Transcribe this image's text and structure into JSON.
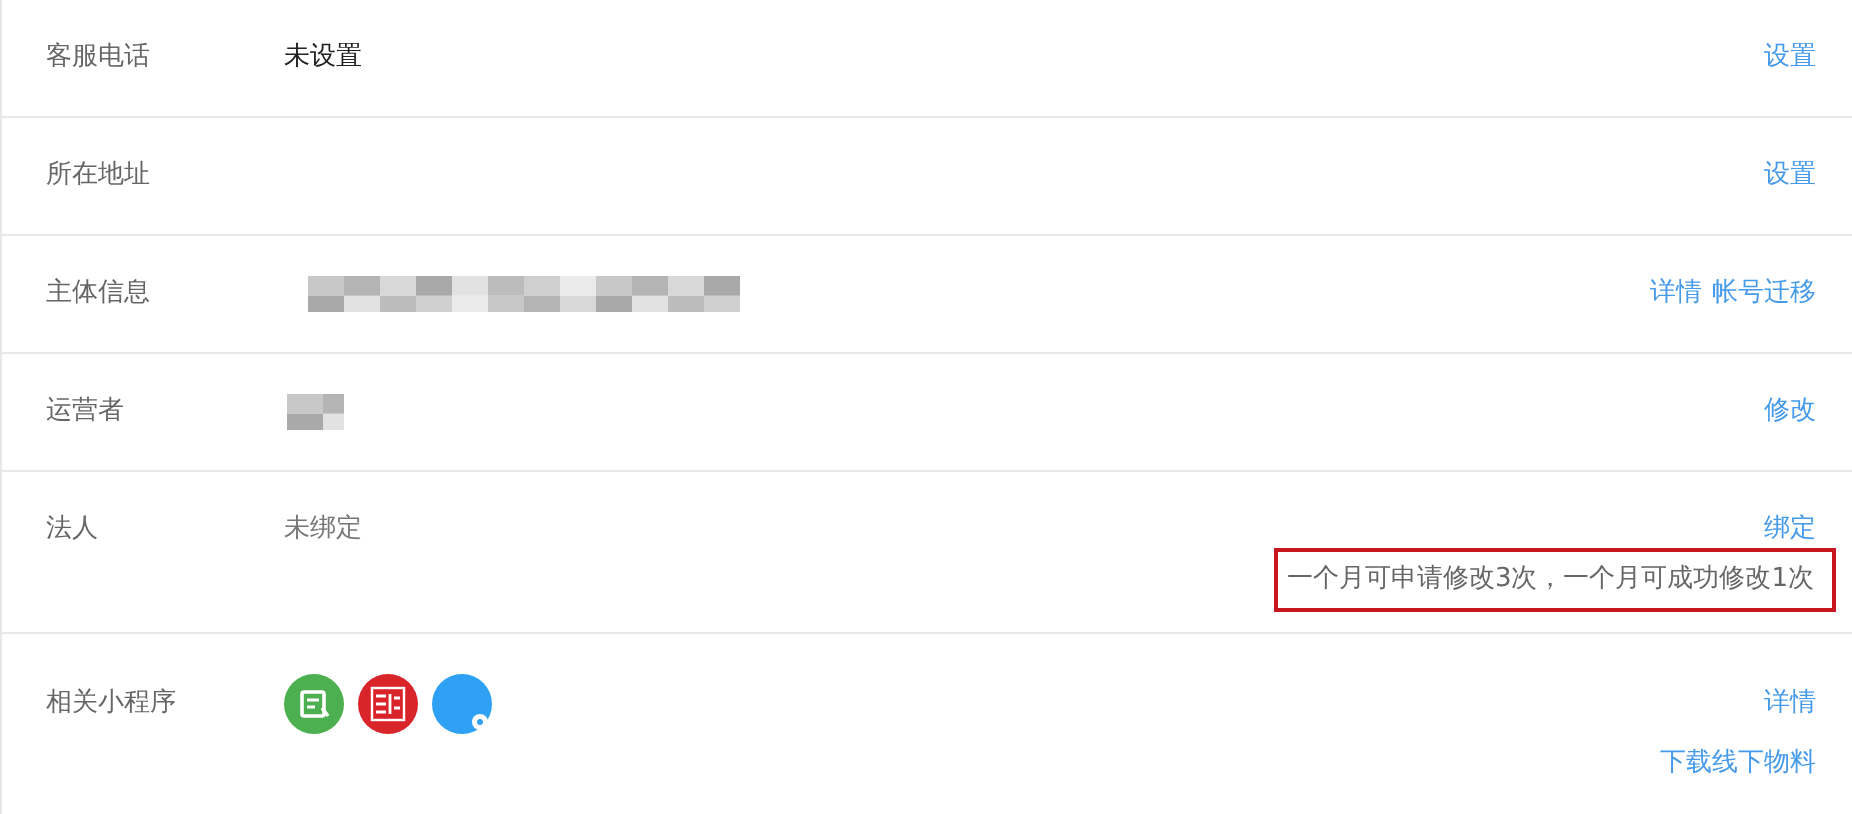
{
  "rows": [
    {
      "label": "客服电话",
      "value": {
        "kind": "text",
        "text": "未设置"
      },
      "action_lines": [
        [
          "设置"
        ]
      ]
    },
    {
      "label": "所在地址",
      "value": {
        "kind": "none"
      },
      "action_lines": [
        [
          "设置"
        ]
      ]
    },
    {
      "label": "主体信息",
      "value": {
        "kind": "blurred"
      },
      "action_lines": [
        [
          "详情",
          "帐号迁移"
        ]
      ]
    },
    {
      "label": "运营者",
      "value": {
        "kind": "speck"
      },
      "action_lines": [
        [
          "修改"
        ]
      ]
    },
    {
      "label": "法人",
      "value": {
        "kind": "muted",
        "text": "未绑定"
      },
      "action_lines": [
        [
          "绑定"
        ]
      ],
      "note": {
        "text": "一个月可申请修改3次，一个月可成功修改1次",
        "highlighted": true
      }
    },
    {
      "label": "相关小程序",
      "value": {
        "kind": "apps",
        "apps": [
          {
            "kind": "doc",
            "color": "#4caf50"
          },
          {
            "kind": "seal",
            "color": "#d9252a"
          },
          {
            "kind": "bubble",
            "color": "#2ea1f5"
          }
        ]
      },
      "action_lines": [
        [
          "详情"
        ],
        [
          "下载线下物料"
        ]
      ]
    }
  ]
}
